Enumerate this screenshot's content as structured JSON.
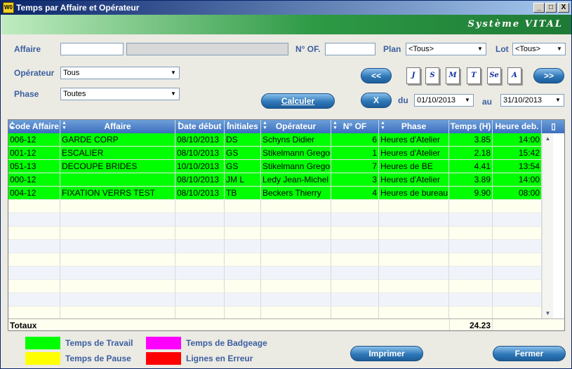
{
  "window": {
    "app_icon": "W0",
    "title": "Temps par  Affaire et Opérateur",
    "minimize": "_",
    "maximize": "□",
    "close": "X",
    "brand": "Système VITAL"
  },
  "filters": {
    "affaire_label": "Affaire",
    "affaire_value": "",
    "affaire_name": "",
    "of_label": "N° OF.",
    "of_value": "",
    "plan_label": "Plan",
    "plan_value": "<Tous>",
    "lot_label": "Lot",
    "lot_value": "<Tous>",
    "operateur_label": "Opérateur",
    "operateur_value": "Tous",
    "phase_label": "Phase",
    "phase_value": "Toutes",
    "calculer": "Calculer",
    "prev": "<<",
    "next": ">>",
    "clear": "X",
    "du_label": "du",
    "du_value": "01/10/2013",
    "au_label": "au",
    "au_value": "31/10/2013",
    "period_buttons": [
      "J",
      "S",
      "M",
      "T",
      "Se",
      "A"
    ]
  },
  "table": {
    "columns": [
      "Code Affaire",
      "Affaire",
      "Date début",
      "Initiales",
      "Opérateur",
      "N° OF",
      "Phase",
      "Temps (H)",
      "Heure deb."
    ],
    "rows": [
      [
        "006-12",
        "GARDE CORP",
        "08/10/2013",
        "DS",
        "Schyns Didier",
        "6",
        "Heures d'Atelier",
        "3.85",
        "14:00"
      ],
      [
        "001-12",
        "ESCALIER",
        "08/10/2013",
        "GS",
        "Stikelmann Gregory",
        "1",
        "Heures d'Atelier",
        "2.18",
        "15:42"
      ],
      [
        "051-13",
        "DECOUPE BRIDES",
        "10/10/2013",
        "GS",
        "Stikelmann Gregory",
        "7",
        "Heures de BE",
        "4.41",
        "13:54"
      ],
      [
        "000-12",
        "",
        "08/10/2013",
        "JM L",
        "Ledy Jean-Michel",
        "3",
        "Heures d'Atelier",
        "3.89",
        "14:00"
      ],
      [
        "004-12",
        "FIXATION VERRS TEST",
        "08/10/2013",
        "TB",
        "Beckers Thierry",
        "4",
        "Heures de bureau",
        "9.90",
        "08:00"
      ]
    ],
    "totals_label": "Totaux",
    "total_time": "24.23"
  },
  "legend": {
    "travail": "Temps de Travail",
    "pause": "Temps de Pause",
    "badgeage": "Temps de Badgeage",
    "erreur": "Lignes en Erreur"
  },
  "buttons": {
    "imprimer": "Imprimer",
    "fermer": "Fermer"
  },
  "colors": {
    "travail": "#00ff00",
    "pause": "#ffff00",
    "badgeage": "#ff00ff",
    "erreur": "#ff0000"
  }
}
